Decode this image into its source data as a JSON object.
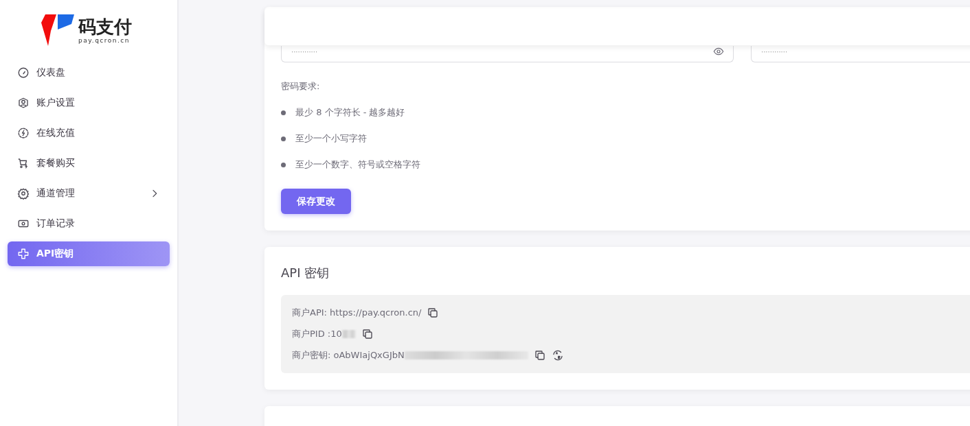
{
  "logo": {
    "name": "码支付",
    "domain": "pay.qcron.cn"
  },
  "sidebar": {
    "items": [
      {
        "label": "仪表盘",
        "kind": "gauge",
        "selected": false,
        "expandable": false
      },
      {
        "label": "账户设置",
        "kind": "user",
        "selected": false,
        "expandable": false
      },
      {
        "label": "在线充值",
        "kind": "bolt",
        "selected": false,
        "expandable": false
      },
      {
        "label": "套餐购买",
        "kind": "cart",
        "selected": false,
        "expandable": false
      },
      {
        "label": "通道管理",
        "kind": "gear",
        "selected": false,
        "expandable": true
      },
      {
        "label": "订单记录",
        "kind": "money",
        "selected": false,
        "expandable": false
      },
      {
        "label": "API密钥",
        "kind": "api",
        "selected": true,
        "expandable": false
      }
    ]
  },
  "password_card": {
    "fields": [
      {
        "value": "············",
        "kind": "revealable"
      },
      {
        "value": "············",
        "kind": "plain"
      }
    ],
    "requirements_title": "密码要求:",
    "requirements": [
      "最少 8 个字符长 - 越多越好",
      "至少一个小写字符",
      "至少一个数字、符号或空格字符"
    ],
    "save_button": "保存更改"
  },
  "api_card": {
    "title": "API 密钥",
    "rows": [
      {
        "text": "商户API: https://pay.qcron.cn/",
        "redacted": false,
        "kind": "copy"
      },
      {
        "text": "商户PID :10",
        "redacted": true,
        "kind": "copy"
      },
      {
        "text": "商户密钥: oAbWIajQxGJbN",
        "redacted": true,
        "kind": "regenerate"
      }
    ]
  }
}
